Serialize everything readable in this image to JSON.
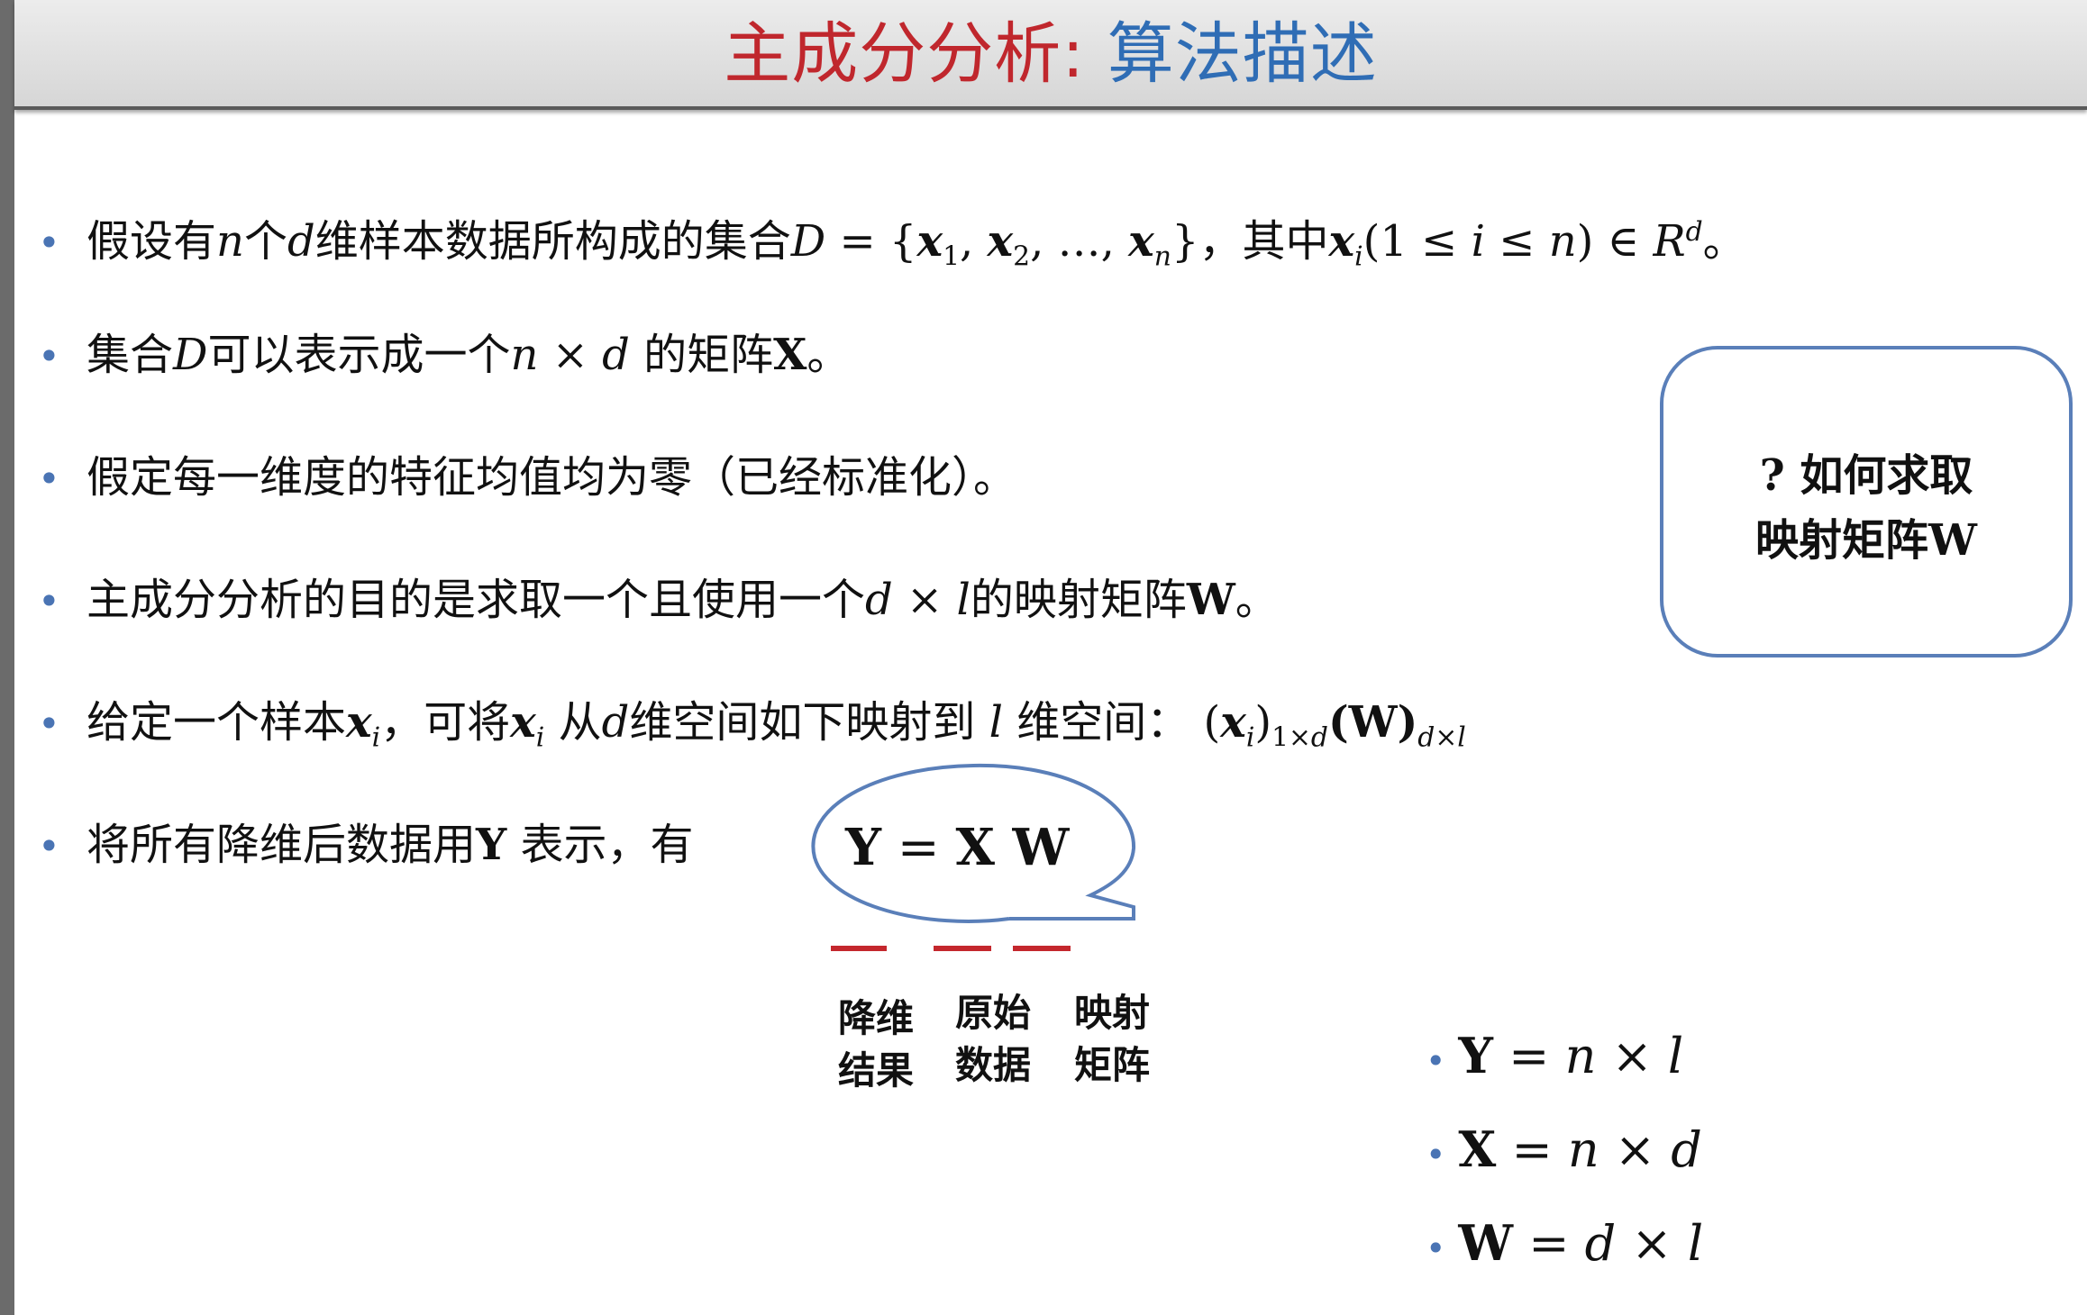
{
  "title": {
    "part1": "主成分分析:",
    "part2": " 算法描述"
  },
  "bullets": {
    "b1": {
      "t1": "假设有",
      "n": "n",
      "t2": "个",
      "d": "d",
      "t3": "维样本数据所构成的集合",
      "D": "D",
      "set": " = {",
      "x": "x",
      "s1": "1",
      "s2": "2",
      "sn": "n",
      "dots": ", …, ",
      "comma": ", ",
      "close": "}",
      "t4": "，其中",
      "si": "i",
      "cond1": "(1 ≤ ",
      "i": "i",
      "cond2": " ≤ ",
      "cond3": ") ∈ ",
      "R": "R",
      "end": "。"
    },
    "b2": {
      "t1": "集合",
      "D": "D",
      "t2": "可以表示成一个",
      "n": "n",
      "times": " × ",
      "d": "d",
      "t3": " 的矩阵",
      "X": "X",
      "end": "。"
    },
    "b3": {
      "text": "假定每一维度的特征均值均为零（已经标准化）。"
    },
    "b4": {
      "t1": "主成分分析的目的是求取一个且使用一个",
      "d": "d",
      "times": " × ",
      "l": "l",
      "t2": "的映射矩阵",
      "W": "W",
      "end": "。"
    },
    "b5": {
      "t1": "给定一个样本",
      "x": "x",
      "i": "i",
      "t2": "，可将",
      "t3": " 从",
      "d": "d",
      "t4": "维空间如下映射到 ",
      "l": "l",
      "t5": " 维空间：",
      "expr_open": " (",
      "expr_close": ")",
      "sub1a": "1×",
      "W": "(W)",
      "sub2b": "×",
      "space": " "
    },
    "b6": {
      "t1": "将所有降维后数据用",
      "Y": "Y",
      "t2": " 表示，有"
    }
  },
  "equation": {
    "Y": "Y",
    "eq": " = ",
    "X": "X",
    "W": " W"
  },
  "labels": {
    "l1a": "降维",
    "l1b": "结果",
    "l2a": "原始",
    "l2b": "数据",
    "l3a": "映射",
    "l3b": "矩阵"
  },
  "callout": {
    "line1": "? 如何求取",
    "line2": "映射矩阵W"
  },
  "formulas": {
    "f1": {
      "M": "Y",
      "eq": " = ",
      "a": "n",
      "x": " × ",
      "b": "l"
    },
    "f2": {
      "M": "X",
      "eq": " = ",
      "a": "n",
      "x": " × ",
      "b": "d"
    },
    "f3": {
      "M": "W",
      "eq": " = ",
      "a": "d",
      "x": " × ",
      "b": "l"
    }
  },
  "colors": {
    "title_red": "#c0272d",
    "title_blue": "#2f6db5",
    "bullet": "#4a74b4",
    "underline": "#c4272d",
    "outline": "#5a7fb9"
  }
}
